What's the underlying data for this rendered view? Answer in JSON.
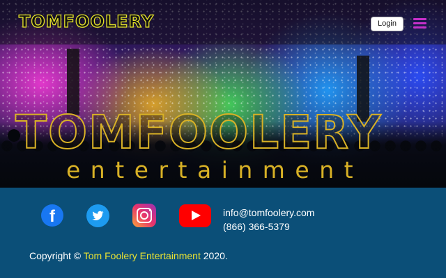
{
  "header": {
    "logo_text": "TOMFOOLERY",
    "login_label": "Login"
  },
  "hero": {
    "logo_main": "TOMFOOLERY",
    "logo_sub": "entertainment"
  },
  "footer": {
    "email": "info@tomfoolery.com",
    "phone": "(866) 366-5379",
    "copyright_prefix": "Copyright ©",
    "copyright_brand": "Tom Foolery Entertainment",
    "copyright_suffix": "2020.",
    "social": [
      "facebook-icon",
      "twitter-icon",
      "instagram-icon",
      "youtube-icon"
    ]
  },
  "colors": {
    "footer_bg": "#0b4f78",
    "logo_yellow": "#e3e12a",
    "brand_text": "#e9e233",
    "menu_magenta": "#c430c8"
  }
}
